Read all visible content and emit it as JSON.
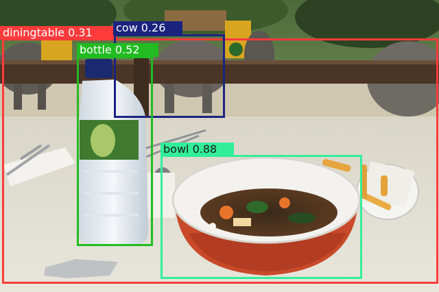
{
  "detections": [
    {
      "label": "diningtable 0.31",
      "color": "#ff3b3b",
      "text_color": "#ffffff"
    },
    {
      "label": "cow 0.26",
      "color": "#1a237e",
      "text_color": "#ffffff"
    },
    {
      "label": "bottle 0.52",
      "color": "#22bb22",
      "text_color": "#ffffff"
    },
    {
      "label": "bowl 0.88",
      "color": "#33ee99",
      "text_color": "#1a1a1a"
    }
  ]
}
